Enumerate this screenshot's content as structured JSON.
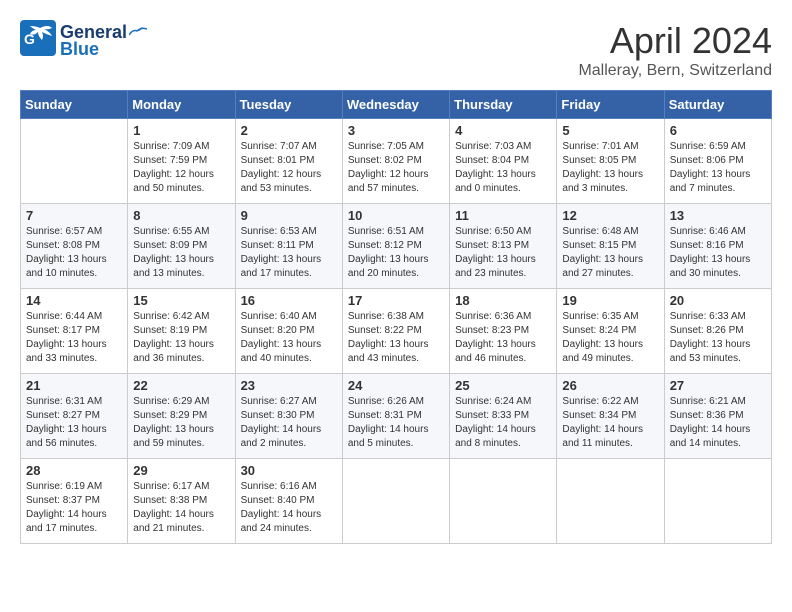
{
  "header": {
    "logo_general": "General",
    "logo_blue": "Blue",
    "month": "April 2024",
    "location": "Malleray, Bern, Switzerland"
  },
  "weekdays": [
    "Sunday",
    "Monday",
    "Tuesday",
    "Wednesday",
    "Thursday",
    "Friday",
    "Saturday"
  ],
  "weeks": [
    [
      {
        "day": "",
        "info": ""
      },
      {
        "day": "1",
        "info": "Sunrise: 7:09 AM\nSunset: 7:59 PM\nDaylight: 12 hours\nand 50 minutes."
      },
      {
        "day": "2",
        "info": "Sunrise: 7:07 AM\nSunset: 8:01 PM\nDaylight: 12 hours\nand 53 minutes."
      },
      {
        "day": "3",
        "info": "Sunrise: 7:05 AM\nSunset: 8:02 PM\nDaylight: 12 hours\nand 57 minutes."
      },
      {
        "day": "4",
        "info": "Sunrise: 7:03 AM\nSunset: 8:04 PM\nDaylight: 13 hours\nand 0 minutes."
      },
      {
        "day": "5",
        "info": "Sunrise: 7:01 AM\nSunset: 8:05 PM\nDaylight: 13 hours\nand 3 minutes."
      },
      {
        "day": "6",
        "info": "Sunrise: 6:59 AM\nSunset: 8:06 PM\nDaylight: 13 hours\nand 7 minutes."
      }
    ],
    [
      {
        "day": "7",
        "info": "Sunrise: 6:57 AM\nSunset: 8:08 PM\nDaylight: 13 hours\nand 10 minutes."
      },
      {
        "day": "8",
        "info": "Sunrise: 6:55 AM\nSunset: 8:09 PM\nDaylight: 13 hours\nand 13 minutes."
      },
      {
        "day": "9",
        "info": "Sunrise: 6:53 AM\nSunset: 8:11 PM\nDaylight: 13 hours\nand 17 minutes."
      },
      {
        "day": "10",
        "info": "Sunrise: 6:51 AM\nSunset: 8:12 PM\nDaylight: 13 hours\nand 20 minutes."
      },
      {
        "day": "11",
        "info": "Sunrise: 6:50 AM\nSunset: 8:13 PM\nDaylight: 13 hours\nand 23 minutes."
      },
      {
        "day": "12",
        "info": "Sunrise: 6:48 AM\nSunset: 8:15 PM\nDaylight: 13 hours\nand 27 minutes."
      },
      {
        "day": "13",
        "info": "Sunrise: 6:46 AM\nSunset: 8:16 PM\nDaylight: 13 hours\nand 30 minutes."
      }
    ],
    [
      {
        "day": "14",
        "info": "Sunrise: 6:44 AM\nSunset: 8:17 PM\nDaylight: 13 hours\nand 33 minutes."
      },
      {
        "day": "15",
        "info": "Sunrise: 6:42 AM\nSunset: 8:19 PM\nDaylight: 13 hours\nand 36 minutes."
      },
      {
        "day": "16",
        "info": "Sunrise: 6:40 AM\nSunset: 8:20 PM\nDaylight: 13 hours\nand 40 minutes."
      },
      {
        "day": "17",
        "info": "Sunrise: 6:38 AM\nSunset: 8:22 PM\nDaylight: 13 hours\nand 43 minutes."
      },
      {
        "day": "18",
        "info": "Sunrise: 6:36 AM\nSunset: 8:23 PM\nDaylight: 13 hours\nand 46 minutes."
      },
      {
        "day": "19",
        "info": "Sunrise: 6:35 AM\nSunset: 8:24 PM\nDaylight: 13 hours\nand 49 minutes."
      },
      {
        "day": "20",
        "info": "Sunrise: 6:33 AM\nSunset: 8:26 PM\nDaylight: 13 hours\nand 53 minutes."
      }
    ],
    [
      {
        "day": "21",
        "info": "Sunrise: 6:31 AM\nSunset: 8:27 PM\nDaylight: 13 hours\nand 56 minutes."
      },
      {
        "day": "22",
        "info": "Sunrise: 6:29 AM\nSunset: 8:29 PM\nDaylight: 13 hours\nand 59 minutes."
      },
      {
        "day": "23",
        "info": "Sunrise: 6:27 AM\nSunset: 8:30 PM\nDaylight: 14 hours\nand 2 minutes."
      },
      {
        "day": "24",
        "info": "Sunrise: 6:26 AM\nSunset: 8:31 PM\nDaylight: 14 hours\nand 5 minutes."
      },
      {
        "day": "25",
        "info": "Sunrise: 6:24 AM\nSunset: 8:33 PM\nDaylight: 14 hours\nand 8 minutes."
      },
      {
        "day": "26",
        "info": "Sunrise: 6:22 AM\nSunset: 8:34 PM\nDaylight: 14 hours\nand 11 minutes."
      },
      {
        "day": "27",
        "info": "Sunrise: 6:21 AM\nSunset: 8:36 PM\nDaylight: 14 hours\nand 14 minutes."
      }
    ],
    [
      {
        "day": "28",
        "info": "Sunrise: 6:19 AM\nSunset: 8:37 PM\nDaylight: 14 hours\nand 17 minutes."
      },
      {
        "day": "29",
        "info": "Sunrise: 6:17 AM\nSunset: 8:38 PM\nDaylight: 14 hours\nand 21 minutes."
      },
      {
        "day": "30",
        "info": "Sunrise: 6:16 AM\nSunset: 8:40 PM\nDaylight: 14 hours\nand 24 minutes."
      },
      {
        "day": "",
        "info": ""
      },
      {
        "day": "",
        "info": ""
      },
      {
        "day": "",
        "info": ""
      },
      {
        "day": "",
        "info": ""
      }
    ]
  ]
}
